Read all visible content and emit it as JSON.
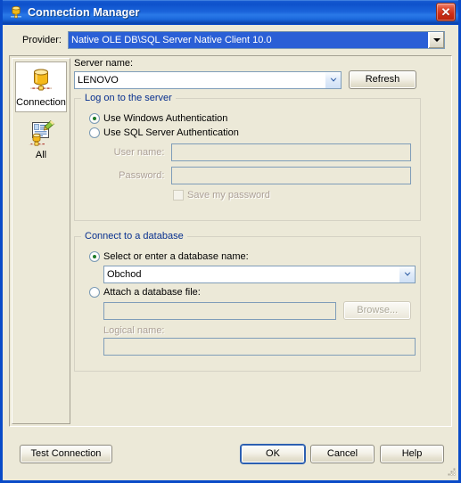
{
  "window": {
    "title": "Connection Manager",
    "title_icon": "database-connection-icon",
    "close_label": "✕",
    "accent_title_bar": "#0e52cc",
    "dialog_background": "#ece9d8",
    "group_title_color": "#08308f",
    "selection_color": "#2a5fd6"
  },
  "provider": {
    "label": "Provider:",
    "value": "Native OLE DB\\SQL Server Native Client 10.0",
    "arrow_icon": "chevron-down-icon"
  },
  "sidebar": {
    "items": [
      {
        "label": "Connection",
        "icon": "database-icon",
        "selected": true
      },
      {
        "label": "All",
        "icon": "properties-list-icon",
        "selected": false
      }
    ]
  },
  "main": {
    "server_name": {
      "label": "Server name:",
      "value": "LENOVO",
      "placeholder": "",
      "arrow_icon": "chevron-down-icon",
      "refresh_label": "Refresh"
    },
    "logon_group": {
      "title": "Log on to the server",
      "radios": [
        {
          "label": "Use Windows Authentication",
          "selected": true
        },
        {
          "label": "Use SQL Server Authentication",
          "selected": false
        }
      ],
      "user_name": {
        "label": "User name:",
        "value": "",
        "placeholder": "",
        "disabled": true
      },
      "password": {
        "label": "Password:",
        "value": "",
        "placeholder": "",
        "disabled": true
      },
      "save_password": {
        "label": "Save my password",
        "checked": false,
        "disabled": true
      }
    },
    "database_group": {
      "title": "Connect to a database",
      "select_radio": {
        "label": "Select or enter a database name:",
        "selected": true
      },
      "database_combo": {
        "value": "Obchod",
        "placeholder": "",
        "arrow_icon": "chevron-down-icon"
      },
      "attach_radio": {
        "label": "Attach a database file:",
        "selected": false
      },
      "attach_file": {
        "value": "",
        "placeholder": "",
        "disabled": true
      },
      "browse_label": "Browse...",
      "logical_name": {
        "label": "Logical name:",
        "value": "",
        "placeholder": "",
        "disabled": true
      }
    }
  },
  "footer": {
    "test_connection_label": "Test Connection",
    "ok_label": "OK",
    "cancel_label": "Cancel",
    "help_label": "Help"
  }
}
